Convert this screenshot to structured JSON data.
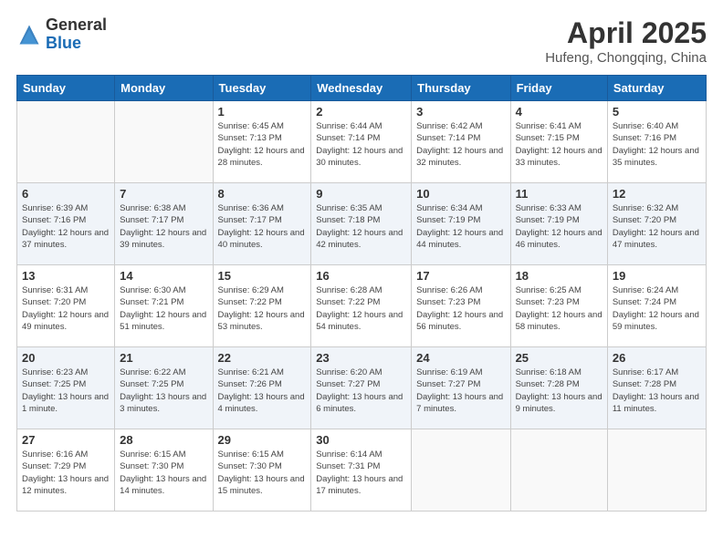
{
  "logo": {
    "general": "General",
    "blue": "Blue"
  },
  "title": "April 2025",
  "subtitle": "Hufeng, Chongqing, China",
  "days_of_week": [
    "Sunday",
    "Monday",
    "Tuesday",
    "Wednesday",
    "Thursday",
    "Friday",
    "Saturday"
  ],
  "weeks": [
    [
      {
        "day": "",
        "info": ""
      },
      {
        "day": "",
        "info": ""
      },
      {
        "day": "1",
        "info": "Sunrise: 6:45 AM\nSunset: 7:13 PM\nDaylight: 12 hours and 28 minutes."
      },
      {
        "day": "2",
        "info": "Sunrise: 6:44 AM\nSunset: 7:14 PM\nDaylight: 12 hours and 30 minutes."
      },
      {
        "day": "3",
        "info": "Sunrise: 6:42 AM\nSunset: 7:14 PM\nDaylight: 12 hours and 32 minutes."
      },
      {
        "day": "4",
        "info": "Sunrise: 6:41 AM\nSunset: 7:15 PM\nDaylight: 12 hours and 33 minutes."
      },
      {
        "day": "5",
        "info": "Sunrise: 6:40 AM\nSunset: 7:16 PM\nDaylight: 12 hours and 35 minutes."
      }
    ],
    [
      {
        "day": "6",
        "info": "Sunrise: 6:39 AM\nSunset: 7:16 PM\nDaylight: 12 hours and 37 minutes."
      },
      {
        "day": "7",
        "info": "Sunrise: 6:38 AM\nSunset: 7:17 PM\nDaylight: 12 hours and 39 minutes."
      },
      {
        "day": "8",
        "info": "Sunrise: 6:36 AM\nSunset: 7:17 PM\nDaylight: 12 hours and 40 minutes."
      },
      {
        "day": "9",
        "info": "Sunrise: 6:35 AM\nSunset: 7:18 PM\nDaylight: 12 hours and 42 minutes."
      },
      {
        "day": "10",
        "info": "Sunrise: 6:34 AM\nSunset: 7:19 PM\nDaylight: 12 hours and 44 minutes."
      },
      {
        "day": "11",
        "info": "Sunrise: 6:33 AM\nSunset: 7:19 PM\nDaylight: 12 hours and 46 minutes."
      },
      {
        "day": "12",
        "info": "Sunrise: 6:32 AM\nSunset: 7:20 PM\nDaylight: 12 hours and 47 minutes."
      }
    ],
    [
      {
        "day": "13",
        "info": "Sunrise: 6:31 AM\nSunset: 7:20 PM\nDaylight: 12 hours and 49 minutes."
      },
      {
        "day": "14",
        "info": "Sunrise: 6:30 AM\nSunset: 7:21 PM\nDaylight: 12 hours and 51 minutes."
      },
      {
        "day": "15",
        "info": "Sunrise: 6:29 AM\nSunset: 7:22 PM\nDaylight: 12 hours and 53 minutes."
      },
      {
        "day": "16",
        "info": "Sunrise: 6:28 AM\nSunset: 7:22 PM\nDaylight: 12 hours and 54 minutes."
      },
      {
        "day": "17",
        "info": "Sunrise: 6:26 AM\nSunset: 7:23 PM\nDaylight: 12 hours and 56 minutes."
      },
      {
        "day": "18",
        "info": "Sunrise: 6:25 AM\nSunset: 7:23 PM\nDaylight: 12 hours and 58 minutes."
      },
      {
        "day": "19",
        "info": "Sunrise: 6:24 AM\nSunset: 7:24 PM\nDaylight: 12 hours and 59 minutes."
      }
    ],
    [
      {
        "day": "20",
        "info": "Sunrise: 6:23 AM\nSunset: 7:25 PM\nDaylight: 13 hours and 1 minute."
      },
      {
        "day": "21",
        "info": "Sunrise: 6:22 AM\nSunset: 7:25 PM\nDaylight: 13 hours and 3 minutes."
      },
      {
        "day": "22",
        "info": "Sunrise: 6:21 AM\nSunset: 7:26 PM\nDaylight: 13 hours and 4 minutes."
      },
      {
        "day": "23",
        "info": "Sunrise: 6:20 AM\nSunset: 7:27 PM\nDaylight: 13 hours and 6 minutes."
      },
      {
        "day": "24",
        "info": "Sunrise: 6:19 AM\nSunset: 7:27 PM\nDaylight: 13 hours and 7 minutes."
      },
      {
        "day": "25",
        "info": "Sunrise: 6:18 AM\nSunset: 7:28 PM\nDaylight: 13 hours and 9 minutes."
      },
      {
        "day": "26",
        "info": "Sunrise: 6:17 AM\nSunset: 7:28 PM\nDaylight: 13 hours and 11 minutes."
      }
    ],
    [
      {
        "day": "27",
        "info": "Sunrise: 6:16 AM\nSunset: 7:29 PM\nDaylight: 13 hours and 12 minutes."
      },
      {
        "day": "28",
        "info": "Sunrise: 6:15 AM\nSunset: 7:30 PM\nDaylight: 13 hours and 14 minutes."
      },
      {
        "day": "29",
        "info": "Sunrise: 6:15 AM\nSunset: 7:30 PM\nDaylight: 13 hours and 15 minutes."
      },
      {
        "day": "30",
        "info": "Sunrise: 6:14 AM\nSunset: 7:31 PM\nDaylight: 13 hours and 17 minutes."
      },
      {
        "day": "",
        "info": ""
      },
      {
        "day": "",
        "info": ""
      },
      {
        "day": "",
        "info": ""
      }
    ]
  ]
}
